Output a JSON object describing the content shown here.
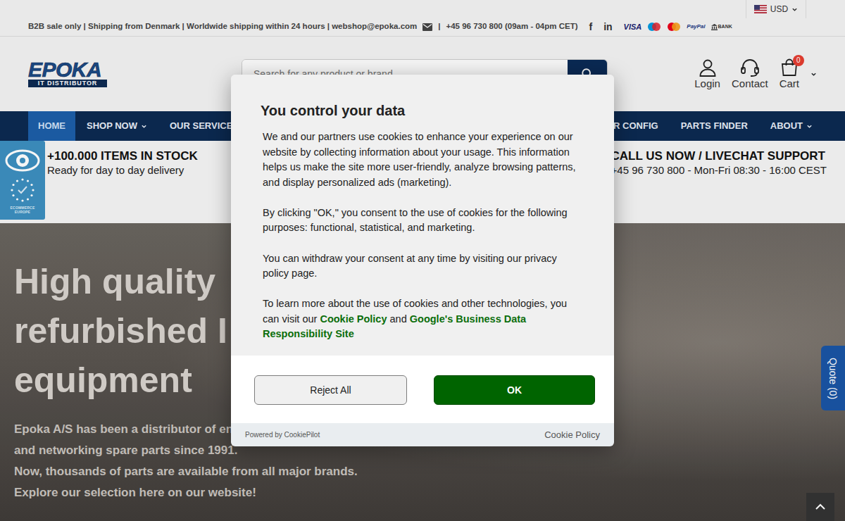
{
  "topbar": {
    "currency": "USD",
    "info": "B2B sale only | Shipping from Denmark | Worldwide shipping within 24 hours | webshop@epoka.com",
    "separator": "|",
    "phone": "+45 96 730 800 (09am - 04pm CET)",
    "social": [
      "f",
      "in"
    ],
    "payments": [
      {
        "kind": "visa",
        "label": "VISA"
      },
      {
        "kind": "maestro"
      },
      {
        "kind": "mastercard"
      },
      {
        "kind": "paypal",
        "label": "PayPal"
      },
      {
        "kind": "bank",
        "label": "BANK"
      }
    ]
  },
  "header": {
    "logo": {
      "name": "EPOKA",
      "tagline": "IT DISTRIBUTOR"
    },
    "search": {
      "placeholder": "Search for any product or brand"
    },
    "actions": [
      {
        "kind": "user",
        "label": "Login"
      },
      {
        "kind": "headset",
        "label": "Contact"
      },
      {
        "kind": "cart",
        "label": "Cart",
        "badge": "0"
      }
    ]
  },
  "nav": {
    "left": [
      {
        "label": "HOME",
        "dropdown": false,
        "selected": true
      },
      {
        "label": "SHOP NOW",
        "dropdown": true,
        "selected": false
      },
      {
        "label": "OUR SERVICES",
        "dropdown": true,
        "selected": false
      }
    ],
    "right": [
      {
        "label": "R CONFIG",
        "dropdown": false,
        "selected": false
      },
      {
        "label": "PARTS FINDER",
        "dropdown": false,
        "selected": false
      },
      {
        "label": "ABOUT",
        "dropdown": true,
        "selected": false
      }
    ]
  },
  "highlights": {
    "badge": "ECOMMERCE EUROPE",
    "left": {
      "title": "+100.000 ITEMS IN STOCK",
      "subtitle": "Ready for day to day delivery"
    },
    "right": {
      "title": "CALL US NOW / LIVECHAT SUPPORT",
      "subtitle": "+45 96 730 800 - Mon-Fri 08:30 - 16:00 CEST"
    }
  },
  "hero": {
    "heading": [
      "High quality",
      "refurbished I",
      "equipment"
    ],
    "text": [
      "Epoka A/S has been a distributor of en",
      "and networking spare parts since 1991.",
      "Now, thousands of parts are available from all major brands.",
      "Explore our selection here on our website!"
    ]
  },
  "modal": {
    "title": "You control your data",
    "paragraphs": [
      [
        {
          "kind": "text",
          "text": "We and our partners use cookies to enhance your experience on our website by collecting information about your usage. This information helps us make the site more user-friendly, analyze browsing patterns, and display personalized ads (marketing)."
        }
      ],
      [
        {
          "kind": "text",
          "text": "By clicking \"OK,\" you consent to the use of cookies for the following purposes: functional, statistical, and marketing."
        }
      ],
      [
        {
          "kind": "text",
          "text": "You can withdraw your consent at any time by visiting our privacy policy page."
        }
      ],
      [
        {
          "kind": "text",
          "text": "To learn more about the use of cookies and other technologies, you can visit our "
        },
        {
          "kind": "link",
          "text": "Cookie Policy"
        },
        {
          "kind": "text",
          "text": " and "
        },
        {
          "kind": "link",
          "text": "Google's Business Data Responsibility Site"
        }
      ]
    ],
    "buttons": [
      {
        "kind": "reject",
        "label": "Reject All"
      },
      {
        "kind": "accept",
        "label": "OK"
      }
    ],
    "footer": {
      "powered": "Powered by CookiePilot",
      "link": "Cookie Policy"
    }
  },
  "quote_tab": "Quote (0)"
}
